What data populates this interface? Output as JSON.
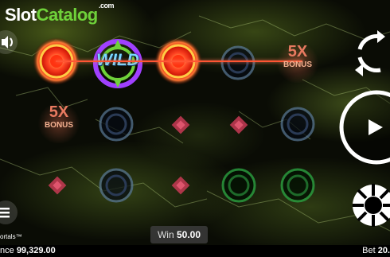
{
  "brand": {
    "part1": "Slot",
    "part2": "Catalog",
    "suffix": ".com"
  },
  "grid": {
    "rows": [
      [
        "red-portal",
        "wild",
        "red-portal",
        "blue-portal",
        "bonus-5x"
      ],
      [
        "bonus-5x",
        "blue-portal",
        "pink-diamond",
        "pink-diamond",
        "blue-portal"
      ],
      [
        "pink-diamond",
        "blue-portal",
        "pink-diamond",
        "green-portal",
        "green-portal"
      ]
    ],
    "wild_label": "WILD",
    "bonus_multiplier": "5X",
    "bonus_label": "BONUS"
  },
  "win": {
    "label": "Win",
    "amount": "50.00"
  },
  "balance": {
    "label_partial": "nce",
    "amount": "99,329.00"
  },
  "bet": {
    "label": "Bet",
    "amount_partial": "20."
  },
  "game_name_partial": "ortals™",
  "icons": [
    "sound-icon",
    "spin-arrows-icon",
    "play-icon",
    "settings-icon",
    "menu-icon"
  ],
  "colors": {
    "accent": "#6fd13a",
    "win_line": "#ff5533"
  }
}
